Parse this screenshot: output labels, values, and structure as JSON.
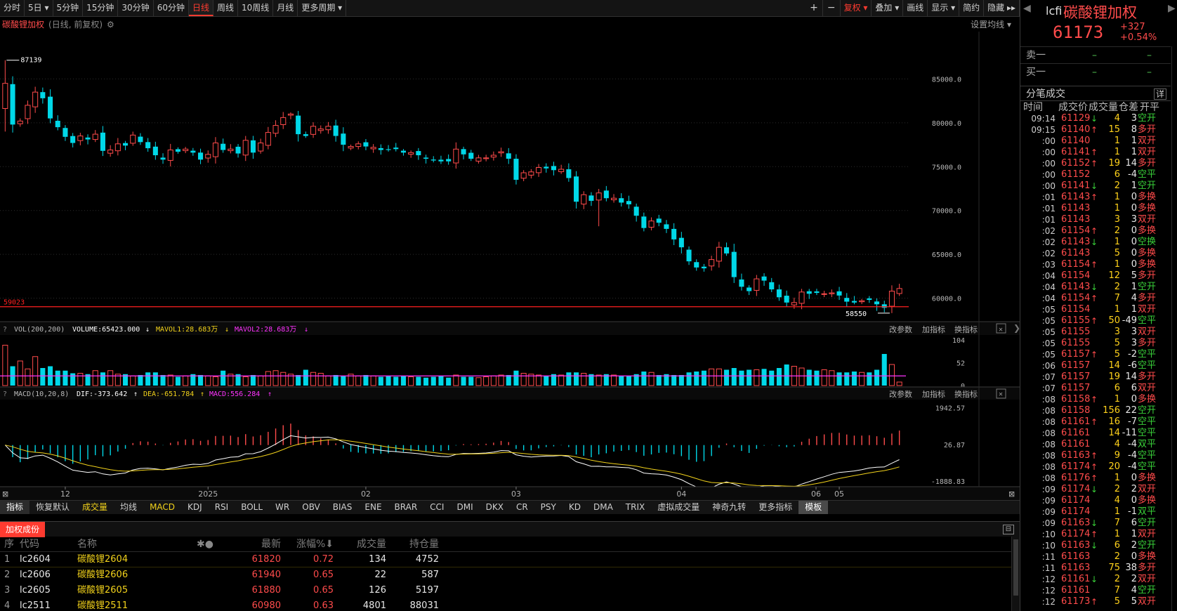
{
  "toolbar": {
    "left": [
      {
        "label": "分时"
      },
      {
        "label": "5日 ▾"
      },
      {
        "label": "5分钟"
      },
      {
        "label": "15分钟"
      },
      {
        "label": "30分钟"
      },
      {
        "label": "60分钟"
      },
      {
        "label": "日线",
        "active": true
      },
      {
        "label": "周线"
      },
      {
        "label": "10周线"
      },
      {
        "label": "月线"
      },
      {
        "label": "更多周期 ▾"
      }
    ],
    "right": [
      {
        "label": "+"
      },
      {
        "label": "−"
      },
      {
        "label": "复权 ▾",
        "accent": true
      },
      {
        "label": "叠加 ▾"
      },
      {
        "label": "画线"
      },
      {
        "label": "显示 ▾"
      },
      {
        "label": "简约"
      },
      {
        "label": "隐藏 ▸▸"
      }
    ]
  },
  "chart_header": {
    "contract": "碳酸锂加权",
    "subtitle": "(日线, 前复权)",
    "settings_label": "设置均线 ▾"
  },
  "colors": {
    "up": "#ff4b4b",
    "down": "#00d8e8",
    "ma1": "#f2d21b",
    "ma2": "#ff33ff",
    "dif": "#ffffff",
    "dea": "#f2d21b",
    "accent": "#ff3b30"
  },
  "chart_data": [
    {
      "type": "candlestick",
      "title": "碳酸锂加权",
      "price_axis_ticks": [
        "85000.0",
        "80000.0",
        "75000.0",
        "70000.0",
        "65000.0",
        "60000.0"
      ],
      "ylim": [
        57400,
        89600
      ],
      "x_labels": [
        "12",
        "2025",
        "02",
        "03",
        "04",
        "05",
        "06"
      ],
      "max_label": "87139",
      "min_label": "58550",
      "level_label": "59023",
      "level": 59023,
      "closes": [
        84500,
        79800,
        80200,
        82000,
        83500,
        82800,
        80500,
        79500,
        78400,
        77700,
        78500,
        78100,
        78700,
        76800,
        76900,
        77600,
        77400,
        78600,
        77800,
        77100,
        76300,
        75800,
        76900,
        76700,
        77000,
        76600,
        75800,
        76400,
        77700,
        76900,
        77000,
        76500,
        78000,
        76600,
        77700,
        78900,
        79700,
        80600,
        81000,
        78700,
        78500,
        79600,
        79300,
        79600,
        78500,
        77500,
        77300,
        77600,
        77300,
        77200,
        76900,
        76900,
        77000,
        76600,
        76600,
        76300,
        75900,
        75700,
        75600,
        75600,
        77000,
        76400,
        75900,
        76000,
        76000,
        76300,
        76700,
        75900,
        73500,
        74300,
        74400,
        74900,
        74800,
        74600,
        74700,
        73700,
        71000,
        71800,
        71100,
        72000,
        71400,
        71400,
        70900,
        70700,
        69400,
        68000,
        68800,
        68600,
        67900,
        66700,
        65800,
        64200,
        63500,
        63400,
        64400,
        65800,
        65100,
        62400,
        61300,
        60800,
        62200,
        62000,
        61000,
        60100,
        59500,
        59500,
        60700,
        60500,
        60600,
        60500,
        60600,
        60300,
        59600,
        59500,
        59700,
        59800,
        59300,
        58900,
        60800,
        61100
      ],
      "macd": {
        "label": "MACD(10,20,8)",
        "dif": -373.642,
        "dea": -651.784,
        "macd": 556.284,
        "axis": [
          "1942.57",
          "26.87",
          "-1888.83"
        ],
        "ylim": [
          -2100,
          2300
        ]
      }
    }
  ],
  "volume_panel": {
    "label": "VOL(200,200)",
    "volume": "VOLUME:65423.000",
    "mavol1": "MAVOL1:28.683万",
    "mavol2": "MAVOL2:28.683万",
    "axis": [
      "104",
      "52",
      "0"
    ],
    "ylim": [
      0,
      112
    ],
    "values": [
      92,
      44,
      56,
      38,
      66,
      40,
      44,
      34,
      34,
      28,
      28,
      26,
      34,
      30,
      34,
      26,
      26,
      22,
      24,
      30,
      30,
      24,
      24,
      20,
      22,
      26,
      24,
      22,
      20,
      34,
      26,
      26,
      20,
      24,
      22,
      32,
      34,
      30,
      26,
      24,
      36,
      30,
      28,
      22,
      24,
      22,
      26,
      22,
      24,
      22,
      20,
      22,
      20,
      22,
      20,
      20,
      18,
      20,
      22,
      18,
      24,
      20,
      20,
      18,
      20,
      22,
      24,
      24,
      34,
      28,
      26,
      24,
      22,
      26,
      24,
      30,
      30,
      28,
      26,
      24,
      26,
      24,
      22,
      22,
      26,
      32,
      30,
      24,
      26,
      24,
      24,
      30,
      32,
      34,
      38,
      38,
      36,
      40,
      34,
      36,
      36,
      38,
      34,
      40,
      48,
      44,
      40,
      36,
      34,
      36,
      34,
      30,
      30,
      32,
      30,
      30,
      36,
      72,
      48,
      8
    ],
    "ma": 22,
    "actions": [
      "改参数",
      "加指标",
      "换指标"
    ]
  },
  "macd_panel": {
    "label": "MACD(10,20,8)",
    "dif_label": "DIF:-373.642",
    "dea_label": "DEA:-651.784",
    "macd_label": "MACD:556.284",
    "actions": [
      "改参数",
      "加指标",
      "换指标"
    ]
  },
  "indicator_tabs": [
    {
      "label": "指标",
      "style": "active"
    },
    {
      "label": "恢复默认"
    },
    {
      "label": "成交量",
      "style": "yellow"
    },
    {
      "label": "均线"
    },
    {
      "label": "MACD",
      "style": "yellow"
    },
    {
      "label": "KDJ"
    },
    {
      "label": "RSI"
    },
    {
      "label": "BOLL"
    },
    {
      "label": "WR"
    },
    {
      "label": "OBV"
    },
    {
      "label": "BIAS"
    },
    {
      "label": "ENE"
    },
    {
      "label": "BRAR"
    },
    {
      "label": "CCI"
    },
    {
      "label": "DMI"
    },
    {
      "label": "DKX"
    },
    {
      "label": "CR"
    },
    {
      "label": "PSY"
    },
    {
      "label": "KD"
    },
    {
      "label": "DMA"
    },
    {
      "label": "TRIX"
    },
    {
      "label": "虚拟成交量"
    },
    {
      "label": "神奇九转"
    },
    {
      "label": "更多指标"
    },
    {
      "label": "模板",
      "style": "selected"
    }
  ],
  "bottom_panel": {
    "tab": "加权成份",
    "columns": [
      "序",
      "代码",
      "名称",
      "✱●",
      "最新",
      "涨幅%⬇",
      "成交量",
      "持仓量"
    ],
    "rows": [
      {
        "idx": "1",
        "code": "lc2604",
        "name": "碳酸锂2604",
        "last": "61820",
        "chg": "0.72",
        "vol": "134",
        "oi": "4752"
      },
      {
        "idx": "2",
        "code": "lc2606",
        "name": "碳酸锂2606",
        "last": "61940",
        "chg": "0.65",
        "vol": "22",
        "oi": "587"
      },
      {
        "idx": "3",
        "code": "lc2605",
        "name": "碳酸锂2605",
        "last": "61880",
        "chg": "0.65",
        "vol": "126",
        "oi": "5197"
      },
      {
        "idx": "4",
        "code": "lc2511",
        "name": "碳酸锂2511",
        "last": "60980",
        "chg": "0.63",
        "vol": "4801",
        "oi": "88031"
      }
    ]
  },
  "quote": {
    "code": "lcfi",
    "name": "碳酸锂加权",
    "price": "61173",
    "change": "+327",
    "change_pct": "+0.54%",
    "sell1_label": "卖一",
    "buy1_label": "买一",
    "empty": "–",
    "ticks_title": "分笔成交",
    "detail_label": "详",
    "tick_columns": [
      "时间",
      "成交价",
      "成交量",
      "仓差",
      "开平"
    ]
  },
  "ticks": [
    {
      "t": "09:14",
      "p": "61129",
      "d": "dn",
      "v": "4",
      "o": "3",
      "k": "空开"
    },
    {
      "t": "09:15",
      "p": "61140",
      "d": "up",
      "v": "15",
      "o": "8",
      "k": "多开"
    },
    {
      "t": ":00",
      "p": "61140",
      "d": "",
      "v": "1",
      "o": "1",
      "k": "双开"
    },
    {
      "t": ":00",
      "p": "61141",
      "d": "up",
      "v": "1",
      "o": "1",
      "k": "双开"
    },
    {
      "t": ":00",
      "p": "61152",
      "d": "up",
      "v": "19",
      "o": "14",
      "k": "多开"
    },
    {
      "t": ":00",
      "p": "61152",
      "d": "",
      "v": "6",
      "o": "-4",
      "k": "空平"
    },
    {
      "t": ":00",
      "p": "61141",
      "d": "dn",
      "v": "2",
      "o": "1",
      "k": "空开"
    },
    {
      "t": ":01",
      "p": "61143",
      "d": "up",
      "v": "1",
      "o": "0",
      "k": "多换"
    },
    {
      "t": ":01",
      "p": "61143",
      "d": "",
      "v": "1",
      "o": "0",
      "k": "多换"
    },
    {
      "t": ":01",
      "p": "61143",
      "d": "",
      "v": "3",
      "o": "3",
      "k": "双开"
    },
    {
      "t": ":02",
      "p": "61154",
      "d": "up",
      "v": "2",
      "o": "0",
      "k": "多换"
    },
    {
      "t": ":02",
      "p": "61143",
      "d": "dn",
      "v": "1",
      "o": "0",
      "k": "空换"
    },
    {
      "t": ":02",
      "p": "61143",
      "d": "",
      "v": "5",
      "o": "0",
      "k": "多换"
    },
    {
      "t": ":03",
      "p": "61154",
      "d": "up",
      "v": "1",
      "o": "0",
      "k": "多换"
    },
    {
      "t": ":04",
      "p": "61154",
      "d": "",
      "v": "12",
      "o": "5",
      "k": "多开"
    },
    {
      "t": ":04",
      "p": "61143",
      "d": "dn",
      "v": "2",
      "o": "1",
      "k": "空开"
    },
    {
      "t": ":04",
      "p": "61154",
      "d": "up",
      "v": "7",
      "o": "4",
      "k": "多开"
    },
    {
      "t": ":05",
      "p": "61154",
      "d": "",
      "v": "1",
      "o": "1",
      "k": "双开"
    },
    {
      "t": ":05",
      "p": "61155",
      "d": "up",
      "v": "50",
      "o": "-49",
      "k": "空平"
    },
    {
      "t": ":05",
      "p": "61155",
      "d": "",
      "v": "3",
      "o": "3",
      "k": "双开"
    },
    {
      "t": ":05",
      "p": "61155",
      "d": "",
      "v": "5",
      "o": "3",
      "k": "多开"
    },
    {
      "t": ":05",
      "p": "61157",
      "d": "up",
      "v": "5",
      "o": "-2",
      "k": "空平"
    },
    {
      "t": ":06",
      "p": "61157",
      "d": "",
      "v": "14",
      "o": "-6",
      "k": "空平"
    },
    {
      "t": ":07",
      "p": "61157",
      "d": "",
      "v": "19",
      "o": "14",
      "k": "多开"
    },
    {
      "t": ":07",
      "p": "61157",
      "d": "",
      "v": "6",
      "o": "6",
      "k": "双开"
    },
    {
      "t": ":08",
      "p": "61158",
      "d": "up",
      "v": "1",
      "o": "0",
      "k": "多换"
    },
    {
      "t": ":08",
      "p": "61158",
      "d": "",
      "v": "156",
      "o": "22",
      "k": "空开"
    },
    {
      "t": ":08",
      "p": "61161",
      "d": "up",
      "v": "16",
      "o": "-7",
      "k": "空平"
    },
    {
      "t": ":08",
      "p": "61161",
      "d": "",
      "v": "14",
      "o": "-11",
      "k": "空平"
    },
    {
      "t": ":08",
      "p": "61161",
      "d": "",
      "v": "4",
      "o": "-4",
      "k": "双平"
    },
    {
      "t": ":08",
      "p": "61163",
      "d": "up",
      "v": "9",
      "o": "-4",
      "k": "空平"
    },
    {
      "t": ":08",
      "p": "61174",
      "d": "up",
      "v": "20",
      "o": "-4",
      "k": "空平"
    },
    {
      "t": ":08",
      "p": "61176",
      "d": "up",
      "v": "1",
      "o": "0",
      "k": "多换"
    },
    {
      "t": ":09",
      "p": "61174",
      "d": "dn",
      "v": "2",
      "o": "2",
      "k": "双开"
    },
    {
      "t": ":09",
      "p": "61174",
      "d": "",
      "v": "4",
      "o": "0",
      "k": "多换"
    },
    {
      "t": ":09",
      "p": "61174",
      "d": "",
      "v": "1",
      "o": "-1",
      "k": "双平"
    },
    {
      "t": ":09",
      "p": "61163",
      "d": "dn",
      "v": "7",
      "o": "6",
      "k": "空开"
    },
    {
      "t": ":10",
      "p": "61174",
      "d": "up",
      "v": "1",
      "o": "1",
      "k": "双开"
    },
    {
      "t": ":10",
      "p": "61163",
      "d": "dn",
      "v": "6",
      "o": "2",
      "k": "空开"
    },
    {
      "t": ":11",
      "p": "61163",
      "d": "",
      "v": "2",
      "o": "0",
      "k": "多换"
    },
    {
      "t": ":11",
      "p": "61163",
      "d": "",
      "v": "75",
      "o": "38",
      "k": "多开"
    },
    {
      "t": ":12",
      "p": "61161",
      "d": "dn",
      "v": "2",
      "o": "2",
      "k": "双开"
    },
    {
      "t": ":12",
      "p": "61161",
      "d": "",
      "v": "7",
      "o": "4",
      "k": "空开"
    },
    {
      "t": ":12",
      "p": "61173",
      "d": "up",
      "v": "5",
      "o": "5",
      "k": "双开"
    }
  ]
}
